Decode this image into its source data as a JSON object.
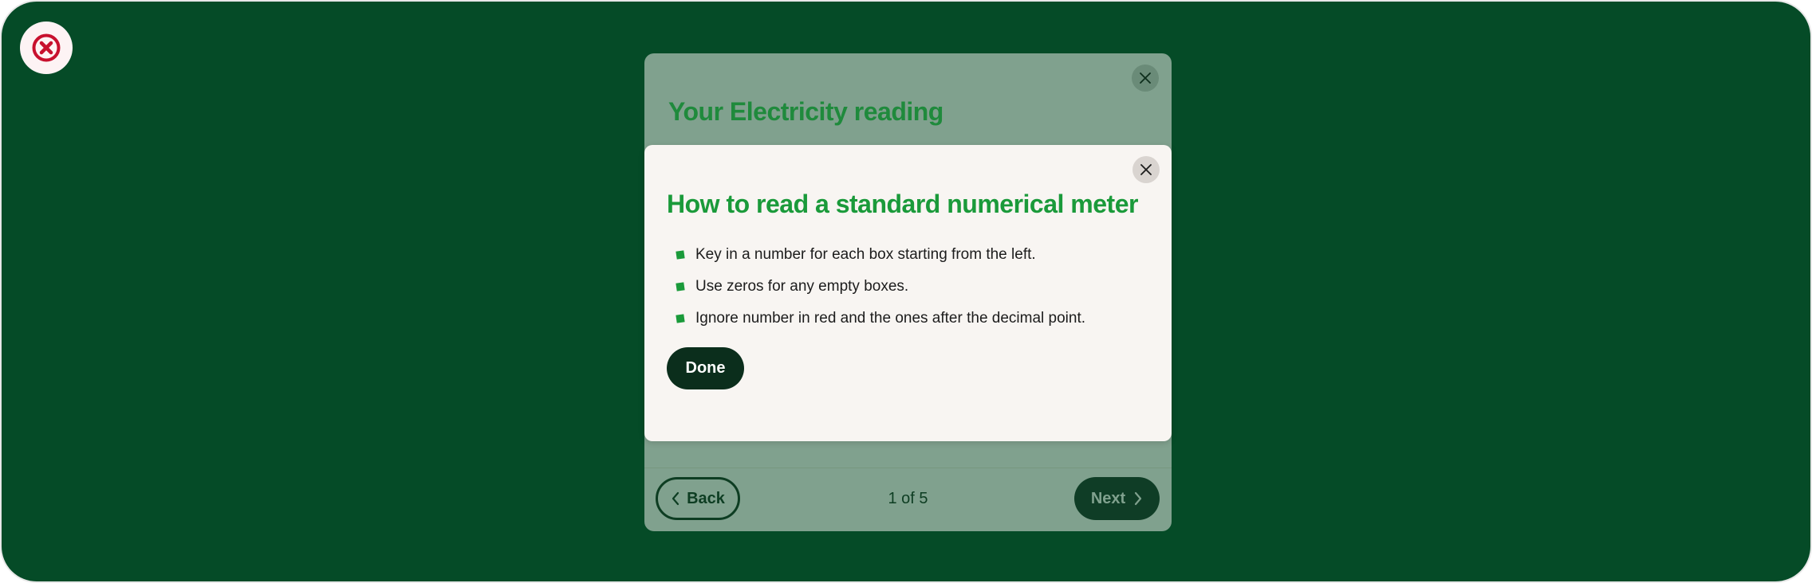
{
  "colors": {
    "background": "#054b27",
    "accent_green": "#1a9a3a",
    "dark_green": "#0b2e1c",
    "error_red": "#c8102e"
  },
  "app": {
    "close_icon": "circle-x-icon"
  },
  "reading_modal": {
    "title": "Your Electricity reading",
    "close_icon": "close-icon",
    "footer": {
      "back_label": "Back",
      "pager": "1 of 5",
      "next_label": "Next"
    }
  },
  "help_dialog": {
    "title": "How to read a standard numerical meter",
    "close_icon": "close-icon",
    "steps": [
      "Key in a number for each box starting from the left.",
      "Use zeros for any empty boxes.",
      "Ignore number in red and the ones after the decimal point."
    ],
    "done_label": "Done"
  }
}
